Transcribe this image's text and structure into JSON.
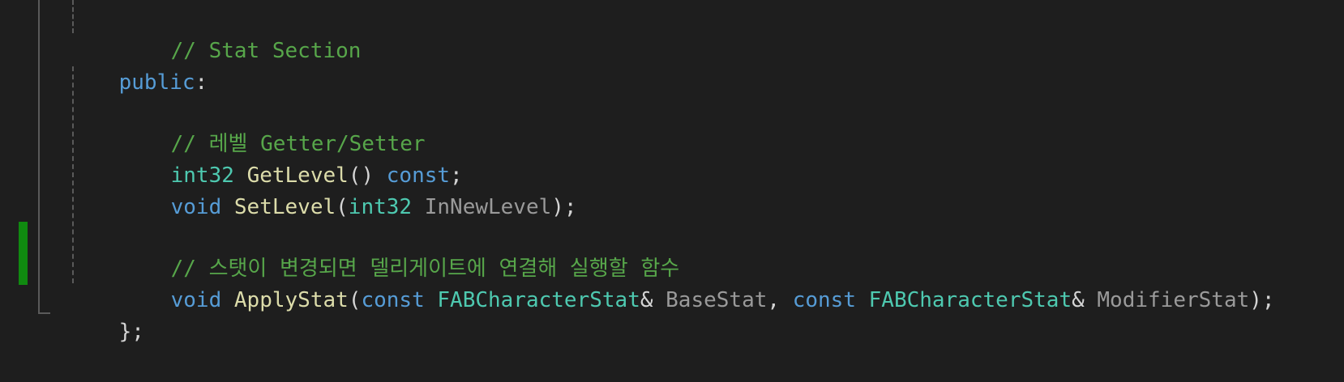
{
  "editor": {
    "colors": {
      "background": "#1e1e1e",
      "comment": "#57a64a",
      "keyword": "#569cd6",
      "type": "#4ec9b0",
      "function": "#dcdcaa",
      "parameter": "#9a9a9a",
      "punctuation": "#d4d4d4",
      "change_marker": "#108a10"
    },
    "lines": [
      {
        "tokens": [
          "// Stat Section"
        ]
      },
      {
        "tokens": [
          "public",
          ":"
        ]
      },
      {
        "tokens": []
      },
      {
        "tokens": [
          "// 레벨 Getter/Setter"
        ]
      },
      {
        "tokens": [
          "int32",
          " ",
          "GetLevel",
          "() ",
          "const",
          ";"
        ]
      },
      {
        "tokens": [
          "void",
          " ",
          "SetLevel",
          "(",
          "int32",
          " ",
          "InNewLevel",
          ");"
        ]
      },
      {
        "tokens": []
      },
      {
        "tokens": [
          "// 스탯이 변경되면 델리게이트에 연결해 실행할 함수"
        ]
      },
      {
        "tokens": [
          "void",
          " ",
          "ApplyStat",
          "(",
          "const",
          " ",
          "FABCharacterStat",
          "& ",
          "BaseStat",
          ", ",
          "const",
          " ",
          "FABCharacterStat",
          "& ",
          "ModifierStat",
          ");"
        ]
      },
      {
        "tokens": [
          "};"
        ]
      }
    ]
  }
}
